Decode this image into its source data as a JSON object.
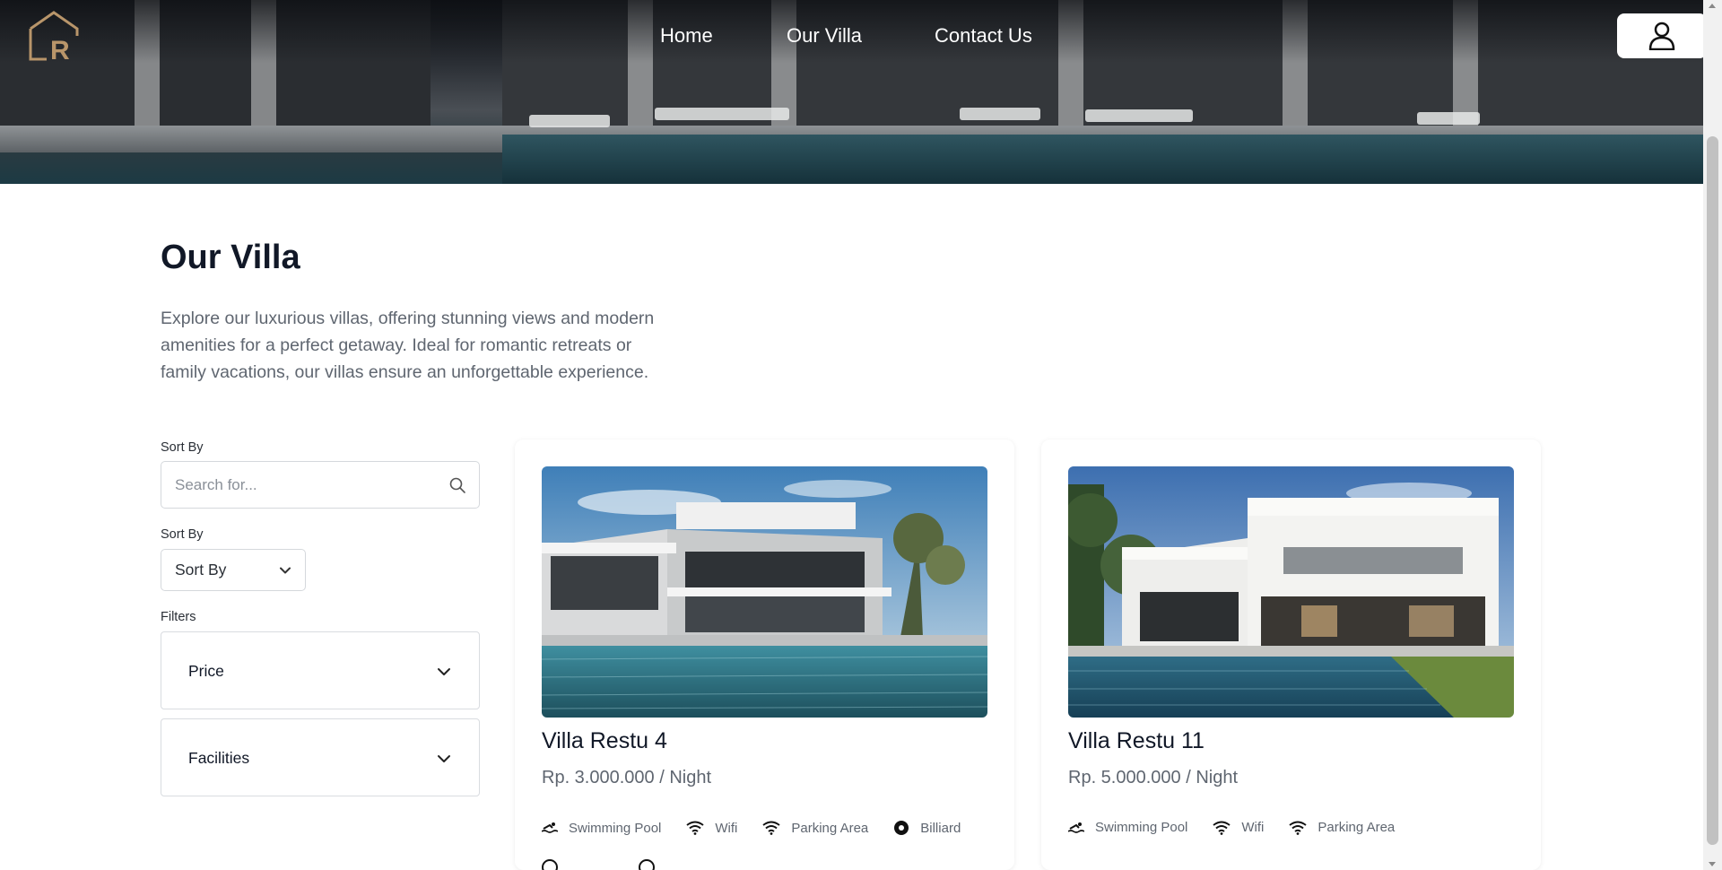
{
  "header": {
    "logo_letter": "R",
    "nav": [
      {
        "label": "Home"
      },
      {
        "label": "Our Villa"
      },
      {
        "label": "Contact Us"
      }
    ],
    "account_icon": "user-icon"
  },
  "intro": {
    "title": "Our Villa",
    "description": "Explore our luxurious villas, offering stunning views and modern amenities for a perfect getaway. Ideal for romantic retreats or family vacations, our villas ensure an unforgettable experience."
  },
  "sidebar": {
    "search_label": "Sort By",
    "search_placeholder": "Search for...",
    "sort_label": "Sort By",
    "sort_value": "Sort By",
    "filters_label": "Filters",
    "filters": [
      {
        "label": "Price"
      },
      {
        "label": "Facilities"
      }
    ]
  },
  "villas": [
    {
      "name": "Villa Restu 4",
      "price": "Rp. 3.000.000 / Night",
      "amenities": [
        {
          "icon": "swimming-icon",
          "label": "Swimming Pool"
        },
        {
          "icon": "wifi-icon",
          "label": "Wifi"
        },
        {
          "icon": "wifi-icon",
          "label": "Parking Area"
        },
        {
          "icon": "billiard-icon",
          "label": "Billiard"
        }
      ]
    },
    {
      "name": "Villa Restu 11",
      "price": "Rp. 5.000.000 / Night",
      "amenities": [
        {
          "icon": "swimming-icon",
          "label": "Swimming Pool"
        },
        {
          "icon": "wifi-icon",
          "label": "Wifi"
        },
        {
          "icon": "wifi-icon",
          "label": "Parking Area"
        }
      ]
    }
  ],
  "colors": {
    "logo": "#b8956a",
    "text_dark": "#111827",
    "text_muted": "#5f6670",
    "border": "#d5d8dc"
  }
}
